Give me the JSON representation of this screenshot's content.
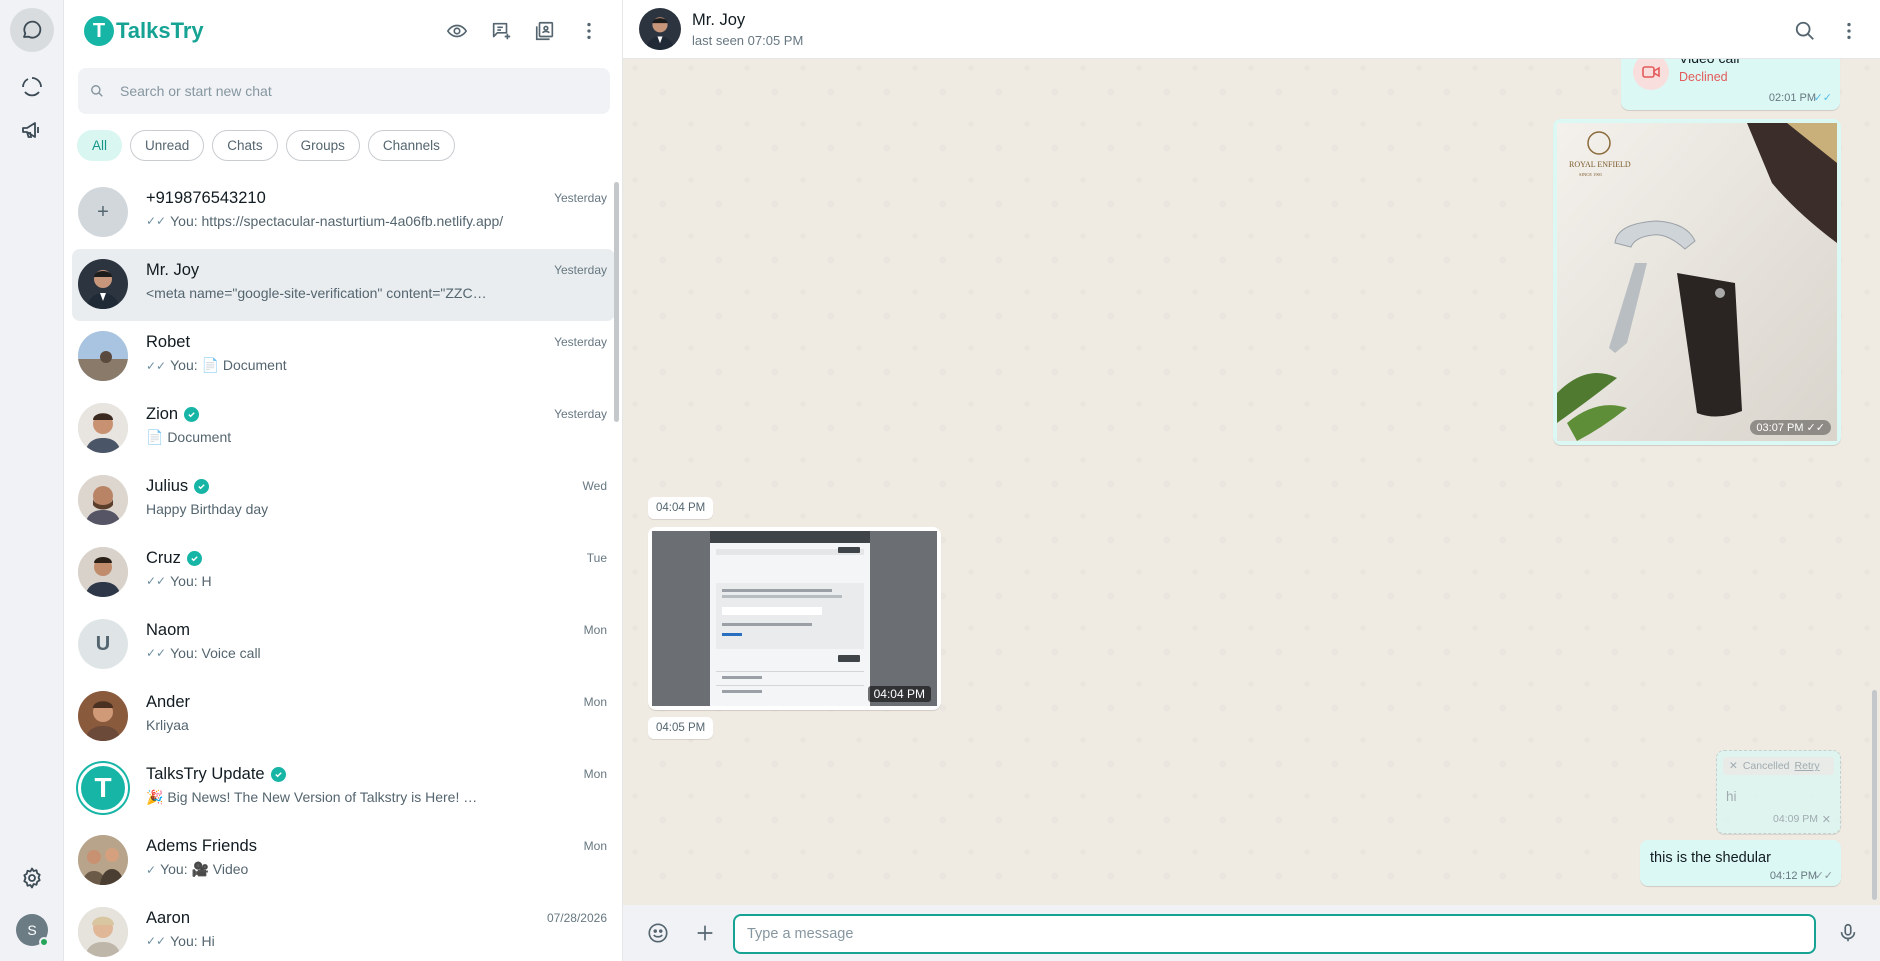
{
  "app": {
    "name": "TalksTry",
    "logo_letter": "T",
    "accent": "#16a394"
  },
  "rail": {
    "items": [
      {
        "name": "chats-icon",
        "active": true
      },
      {
        "name": "status-icon",
        "active": false
      },
      {
        "name": "channels-icon",
        "active": false
      }
    ],
    "settings_icon": "gear-icon",
    "profile_initial": "S"
  },
  "sidebar": {
    "search_placeholder": "Search or start new chat",
    "filters": [
      "All",
      "Unread",
      "Chats",
      "Groups",
      "Channels"
    ],
    "active_filter": "All",
    "chats": [
      {
        "name": "+919876543210",
        "time": "Yesterday",
        "preview": "You: https://spectacular-nasturtium-4a06fb.netlify.app/",
        "tick": "✓✓",
        "avatar_text": "+",
        "verified": false
      },
      {
        "name": "Mr. Joy",
        "time": "Yesterday",
        "preview": "<meta name=\"google-site-verification\" content=\"ZZC…",
        "tick": "",
        "avatar_text": "",
        "verified": false,
        "selected": true
      },
      {
        "name": "Robet",
        "time": "Yesterday",
        "preview": "You: 📄 Document",
        "tick": "✓✓",
        "avatar_text": "",
        "verified": false
      },
      {
        "name": "Zion",
        "time": "Yesterday",
        "preview": "📄 Document",
        "tick": "",
        "avatar_text": "",
        "verified": true
      },
      {
        "name": "Julius",
        "time": "Wed",
        "preview": "Happy Birthday day",
        "tick": "",
        "avatar_text": "",
        "verified": true
      },
      {
        "name": "Cruz",
        "time": "Tue",
        "preview": "You: H",
        "tick": "✓✓",
        "avatar_text": "",
        "verified": true
      },
      {
        "name": "Naom",
        "time": "Mon",
        "preview": "You: Voice call",
        "tick": "✓✓",
        "avatar_text": "U",
        "verified": false
      },
      {
        "name": "Ander",
        "time": "Mon",
        "preview": "Krliyaa",
        "tick": "",
        "avatar_text": "",
        "verified": false
      },
      {
        "name": "TalksTry Update",
        "time": "Mon",
        "preview": "🎉 Big News! The New Version of Talkstry is Here! …",
        "tick": "",
        "avatar_text": "T",
        "verified": true
      },
      {
        "name": "Adems Friends",
        "time": "Mon",
        "preview": "You: 🎥 Video",
        "tick": "✓",
        "avatar_text": "",
        "verified": false
      },
      {
        "name": "Aaron",
        "time": "07/28/2026",
        "preview": "You: Hi",
        "tick": "✓✓",
        "avatar_text": "",
        "verified": false
      }
    ]
  },
  "conversation": {
    "contact_name": "Mr. Joy",
    "last_seen": "last seen 07:05 PM",
    "messages": {
      "video_call": {
        "title": "Video call",
        "status": "Declined",
        "time": "02:01 PM"
      },
      "image_out": {
        "brand": "ROYAL ENFIELD",
        "brand_sub": "SINCE 1901",
        "time": "03:07 PM"
      },
      "date_chip_1": "04:04 PM",
      "image_in": {
        "time": "04:04 PM"
      },
      "date_chip_2": "04:05 PM",
      "cancelled": {
        "label": "Cancelled",
        "retry": "Retry",
        "text": "hi",
        "time": "04:09 PM"
      },
      "last": {
        "text": "this is the shedular",
        "time": "04:12 PM"
      }
    },
    "composer_placeholder": "Type a message"
  }
}
